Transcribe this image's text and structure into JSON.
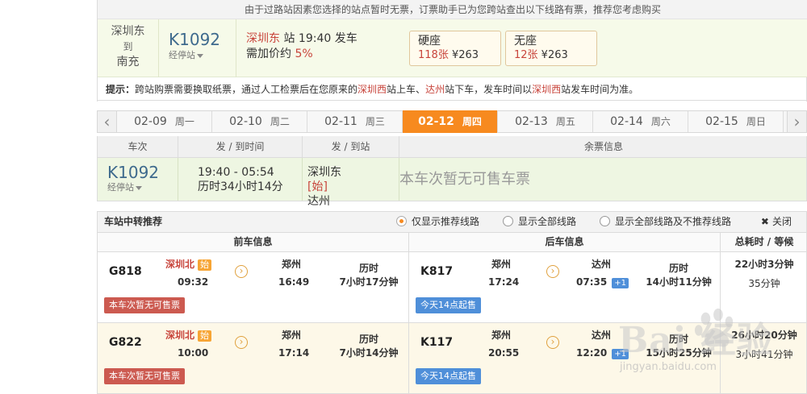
{
  "notice": "由于过路站因素您选择的站点暂时无票，订票助手已为您跨站查出以下线路有票，推荐您考虑购买",
  "route": {
    "from": "深圳东",
    "to_word": "到",
    "to": "南充",
    "train_no": "K1092",
    "via_label": "经停站",
    "info_station": "深圳东",
    "info_station_suffix": " 站 ",
    "info_time": "19:40",
    "info_depart": " 发车",
    "info_extra_label": "需加价约 ",
    "info_extra_value": "5%"
  },
  "seats": [
    {
      "name": "硬座",
      "count": "118张",
      "price": " ¥263"
    },
    {
      "name": "无座",
      "count": "12张",
      "price": " ¥263"
    }
  ],
  "tip": {
    "label": "提示：",
    "text1": "跨站购票需要换取纸票，通过人工检票后在您原来的",
    "st1": "深圳西",
    "text2": "站上车、",
    "st2": "达州",
    "text3": "站下车，发车时间以",
    "st3": "深圳西",
    "text4": "站发车时间为准。"
  },
  "dates": [
    {
      "date": "02-09",
      "week": "周一"
    },
    {
      "date": "02-10",
      "week": "周二"
    },
    {
      "date": "02-11",
      "week": "周三"
    },
    {
      "date": "02-12",
      "week": "周四"
    },
    {
      "date": "02-13",
      "week": "周五"
    },
    {
      "date": "02-14",
      "week": "周六"
    },
    {
      "date": "02-15",
      "week": "周日"
    }
  ],
  "active_date_index": 3,
  "arrows": {
    "left": "‹",
    "right": "›"
  },
  "result_head": {
    "train": "车次",
    "time": "发 / 到时间",
    "station": "发 / 到站",
    "ticket": "余票信息"
  },
  "result": {
    "train_no": "K1092",
    "via_label": "经停站",
    "time_range": "19:40 - 05:54",
    "duration": "历时34小时14分",
    "from": "深圳东",
    "from_tag": "[始]",
    "to": "达州",
    "ticket_status": "本车次暂无可售车票"
  },
  "transfer": {
    "title": "车站中转推荐",
    "opt1": "仅显示推荐线路",
    "opt2": "显示全部线路",
    "opt3": "显示全部线路及不推荐线路",
    "close": "关闭",
    "close_x": "✖",
    "front_head": "前车信息",
    "back_head": "后车信息",
    "total_head": "总耗时 / 等候",
    "shi": "始",
    "arrow_glyph": "›",
    "rows": [
      {
        "f_train": "G818",
        "f_from": "深圳北",
        "f_dep": "09:32",
        "f_to": "郑州",
        "f_arr": "16:49",
        "f_dur1": "历时",
        "f_dur2": "7小时17分钟",
        "f_btn": "本车次暂无可售票",
        "b_train": "K817",
        "b_from": "郑州",
        "b_dep": "17:24",
        "b_to": "达州",
        "b_arr": "07:35",
        "b_plus": "+1",
        "b_dur1": "历时",
        "b_dur2": "14小时11分钟",
        "b_btn": "今天14点起售",
        "total": "22小时3分钟",
        "wait": "35分钟"
      },
      {
        "f_train": "G822",
        "f_from": "深圳北",
        "f_dep": "10:00",
        "f_to": "郑州",
        "f_arr": "17:14",
        "f_dur1": "历时",
        "f_dur2": "7小时14分钟",
        "f_btn": "本车次暂无可售票",
        "b_train": "K117",
        "b_from": "郑州",
        "b_dep": "20:55",
        "b_to": "达州",
        "b_arr": "12:20",
        "b_plus": "+1",
        "b_dur1": "历时",
        "b_dur2": "15小时25分钟",
        "b_btn": "今天14点起售",
        "total": "26小时20分钟",
        "wait": "3小时41分钟"
      }
    ]
  },
  "watermark": {
    "logo": "Bai 经验",
    "sub": "jingyan.baidu.com"
  },
  "colors": {
    "accent": "#f78a1f",
    "red": "#c8443b",
    "blue": "#4f8fd9",
    "train_blue": "#3e6a8d"
  }
}
